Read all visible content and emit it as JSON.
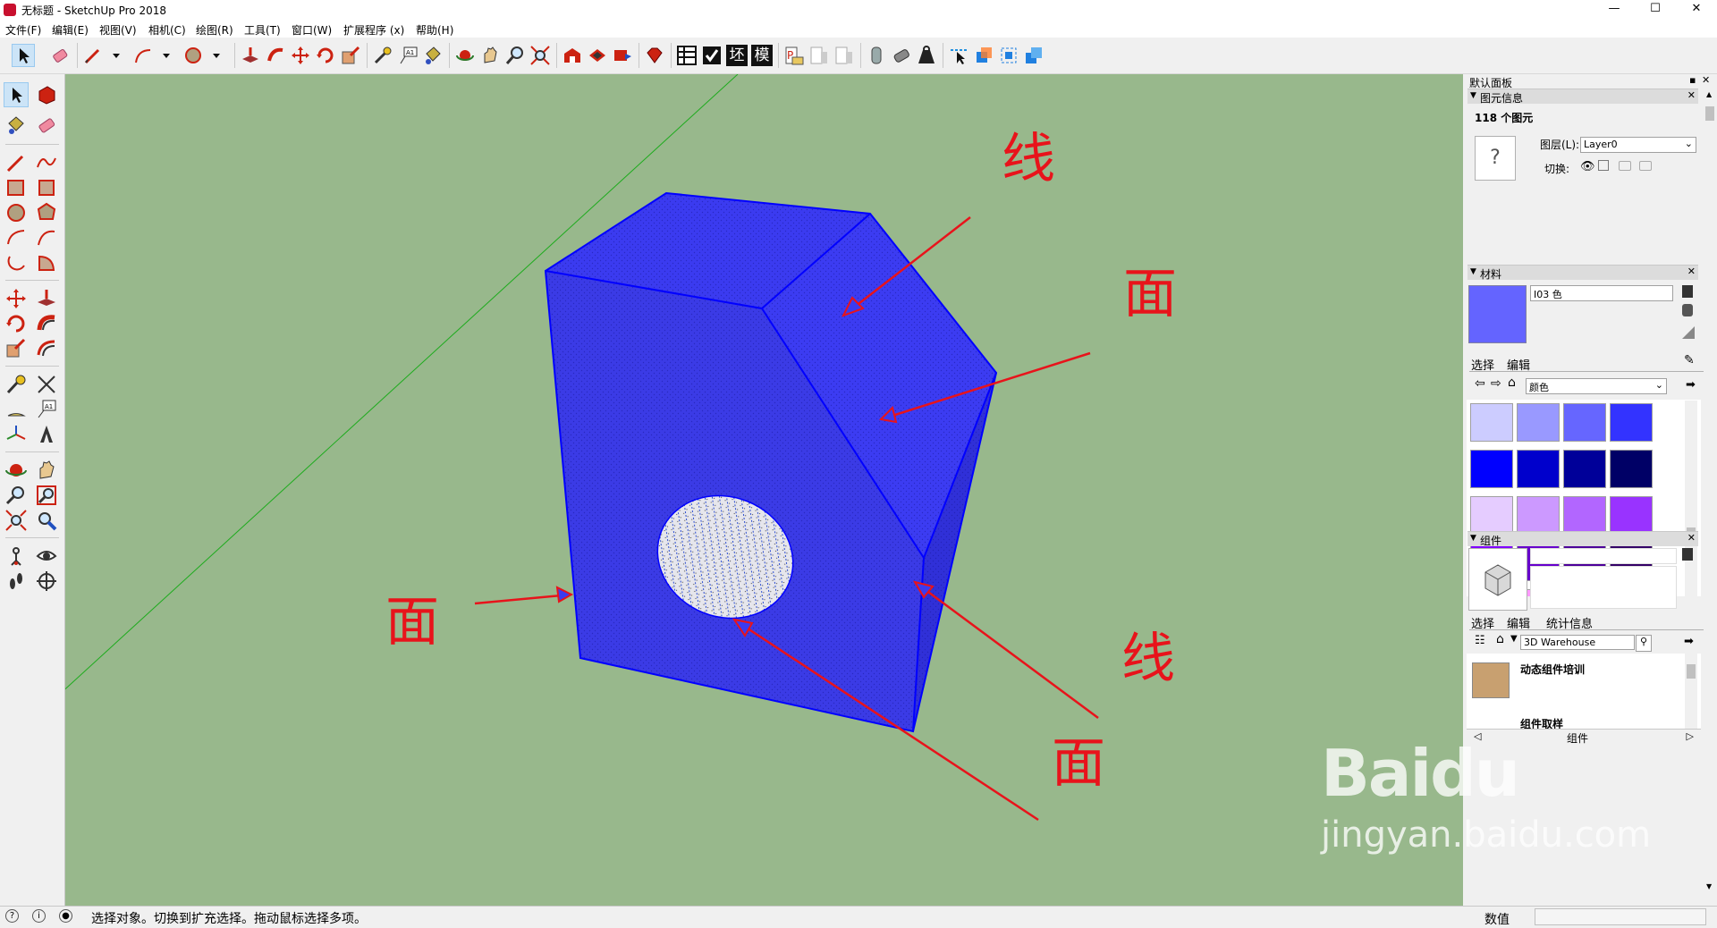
{
  "window": {
    "title": "无标题 - SketchUp Pro 2018",
    "minimize": "—",
    "maximize": "☐",
    "close": "✕"
  },
  "menu": [
    "文件(F)",
    "编辑(E)",
    "视图(V)",
    "相机(C)",
    "绘图(R)",
    "工具(T)",
    "窗口(W)",
    "扩展程序 (x)",
    "帮助(H)"
  ],
  "toolbar": {
    "text_buttons": [
      "坯",
      "模"
    ]
  },
  "annotations": {
    "line_top": "线",
    "face_right": "面",
    "face_left": "面",
    "line_right": "线",
    "face_bottom": "面"
  },
  "colors": {
    "viewport_bg": "#98b88c",
    "cube_face": "#3b3bf0",
    "cube_edge": "#0000ff",
    "arrow": "#e8131b",
    "axis_green": "#1eab1e"
  },
  "panel": {
    "title": "默认面板",
    "entity_info": {
      "header": "图元信息",
      "count": "118 个图元",
      "layer_label": "图层(L):",
      "layer_value": "Layer0",
      "toggle_label": "切换:"
    },
    "materials": {
      "header": "材料",
      "name": "I03 色",
      "current_color": "#6464ff",
      "tabs": [
        "选择",
        "编辑"
      ],
      "library": "颜色",
      "swatches": [
        "#ccccff",
        "#9999ff",
        "#6666ff",
        "#3333ff",
        "#0000ff",
        "#0000cc",
        "#000099",
        "#000066",
        "#e5ccff",
        "#cc99ff",
        "#b266ff",
        "#9933ff",
        "#8000ff",
        "#6600cc",
        "#4c0099",
        "#330066",
        "#ffccff",
        "#ff99ff",
        "#ff66ff",
        "#ff33ff",
        "#ff00ff",
        "#cc00cc",
        "#990099",
        "#660066"
      ]
    },
    "components": {
      "header": "组件",
      "tabs": [
        "选择",
        "编辑",
        "统计信息"
      ],
      "search": "3D Warehouse",
      "items": [
        "动态组件培训",
        "组件取样"
      ],
      "footer": "组件"
    }
  },
  "status": {
    "message": "选择对象。切换到扩充选择。拖动鼠标选择多项。",
    "value_label": "数值"
  },
  "watermark": {
    "brand": "Baidu",
    "site": "jingyan.baidu.com"
  }
}
